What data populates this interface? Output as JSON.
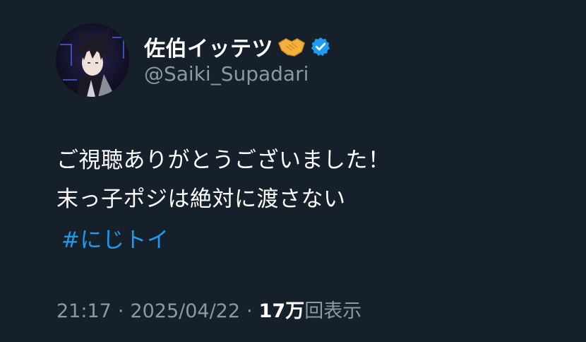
{
  "author": {
    "display_name": "佐伯イッテツ",
    "handle": "@Saiki_Supadari",
    "name_emoji": "handshake",
    "verified": true,
    "verified_color": "#1d9bf0"
  },
  "tweet": {
    "lines": [
      "ご視聴ありがとうございました！",
      "末っ子ポジは絶対に渡さない"
    ],
    "hashtag": "#にじトイ"
  },
  "meta": {
    "time": "21:17",
    "date": "2025/04/22",
    "separator": "·",
    "views_count": "17万",
    "views_label": "回表示"
  },
  "colors": {
    "background": "#15202b",
    "text": "#ffffff",
    "muted": "#8b98a5",
    "link": "#1d9bf0"
  }
}
